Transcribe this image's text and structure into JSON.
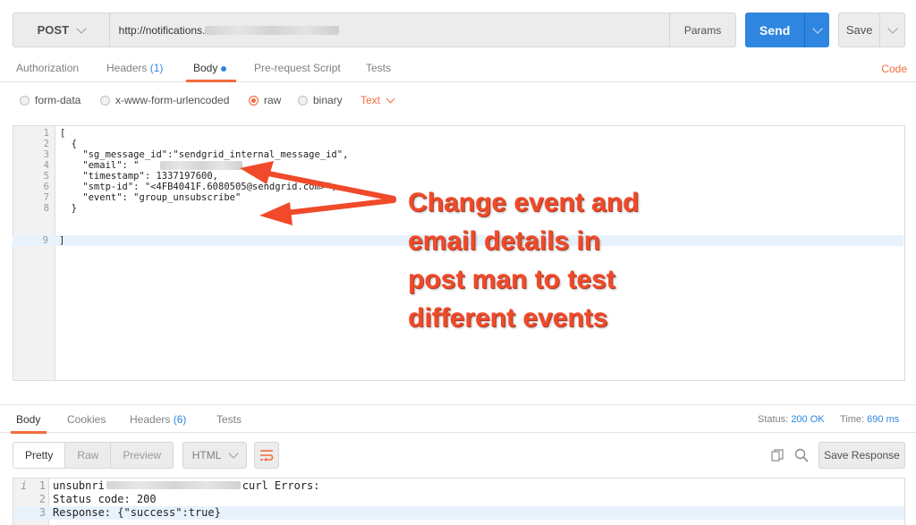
{
  "request": {
    "method": "POST",
    "url": "http://notifications.",
    "params_label": "Params",
    "send_label": "Send",
    "save_label": "Save"
  },
  "request_tabs": {
    "authorization": "Authorization",
    "headers": "Headers",
    "headers_count": "(1)",
    "body": "Body",
    "prerequest": "Pre-request Script",
    "tests": "Tests",
    "code": "Code"
  },
  "body_modes": {
    "form_data": "form-data",
    "urlencoded": "x-www-form-urlencoded",
    "raw": "raw",
    "binary": "binary",
    "selected": "raw",
    "text_type": "Text"
  },
  "editor_lines": [
    {
      "n": "1",
      "text": "["
    },
    {
      "n": "2",
      "text": "  {"
    },
    {
      "n": "3",
      "text": "    \"sg_message_id\":\"sendgrid_internal_message_id\","
    },
    {
      "n": "4",
      "text": "    \"email\": \""
    },
    {
      "n": "5",
      "text": "    \"timestamp\": 1337197600,"
    },
    {
      "n": "6",
      "text": "    \"smtp-id\": \"<4FB4041F.6080505@sendgrid.com>\","
    },
    {
      "n": "7",
      "text": "    \"event\": \"group_unsubscribe\""
    },
    {
      "n": "8",
      "text": "  }"
    },
    {
      "n": "9",
      "text": "]"
    }
  ],
  "annotation": {
    "line1": "Change event and",
    "line2": "email details in",
    "line3": "post man to test",
    "line4": "different events",
    "color": "#f04a2a"
  },
  "response_tabs": {
    "body": "Body",
    "cookies": "Cookies",
    "headers": "Headers",
    "headers_count": "(6)",
    "tests": "Tests",
    "status_label": "Status:",
    "status_value": "200 OK",
    "time_label": "Time:",
    "time_value": "690 ms"
  },
  "response_toolbar": {
    "pretty": "Pretty",
    "raw": "Raw",
    "preview": "Preview",
    "format": "HTML",
    "save_response": "Save Response"
  },
  "response_lines": [
    {
      "n": "1",
      "text_a": "unsubnri",
      "text_b": "curl Errors:"
    },
    {
      "n": "2",
      "text": "Status code: 200"
    },
    {
      "n": "3",
      "text": "Response: {\"success\":true}"
    }
  ],
  "colors": {
    "accent": "#f26b3a",
    "primary": "#2f86e0"
  }
}
